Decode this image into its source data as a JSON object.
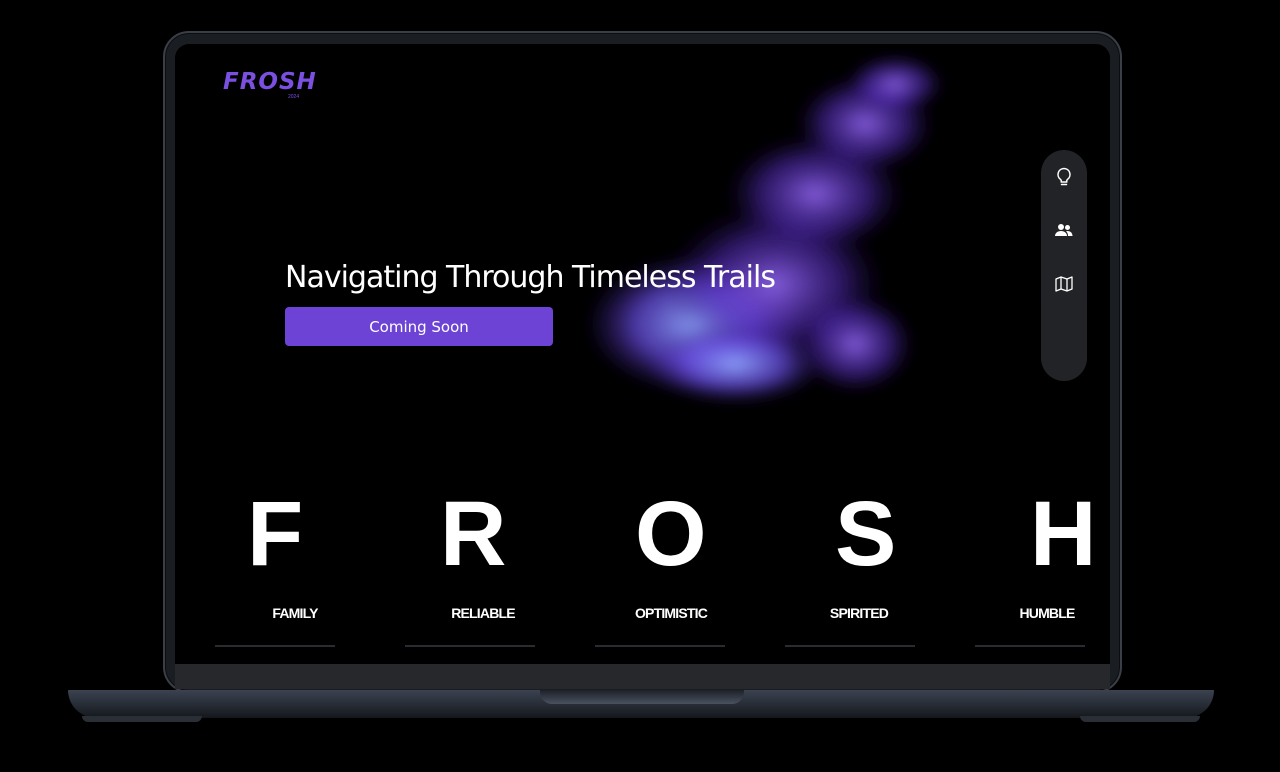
{
  "brand": {
    "logo": "FROSH",
    "logo_sub": "2024",
    "accent": "#6d43d6"
  },
  "hero": {
    "title": "Navigating Through Timeless Trails",
    "cta_label": "Coming Soon"
  },
  "sidenav": {
    "items": [
      {
        "icon": "lightbulb-icon"
      },
      {
        "icon": "users-icon"
      },
      {
        "icon": "map-icon"
      }
    ]
  },
  "values": {
    "letters": [
      "F",
      "R",
      "O",
      "S",
      "H"
    ],
    "words": [
      "FAMILY",
      "RELIABLE",
      "OPTIMISTIC",
      "SPIRITED",
      "HUMBLE"
    ]
  }
}
